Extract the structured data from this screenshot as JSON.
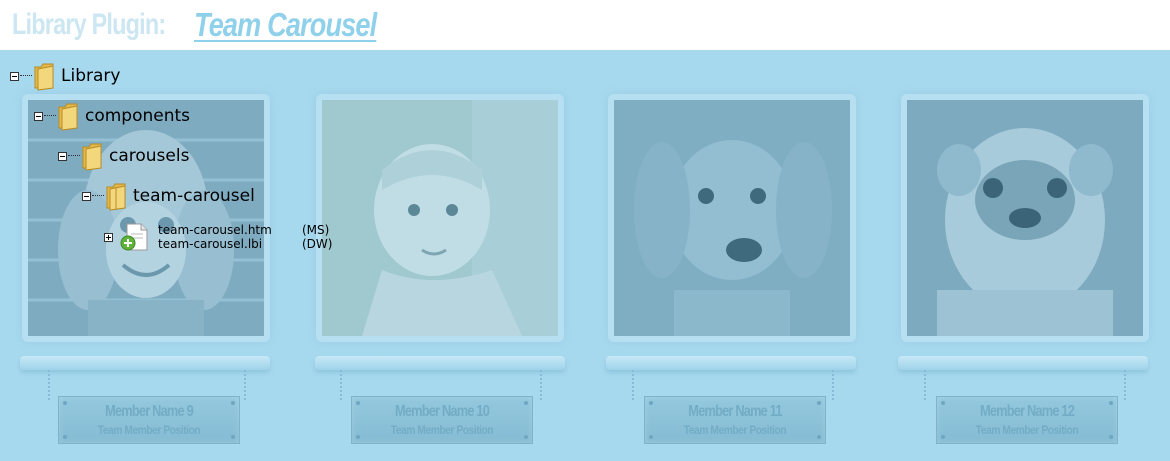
{
  "header": {
    "label": "Library Plugin:",
    "title_link": "Team Carousel"
  },
  "tree": {
    "root": "Library",
    "l1": "components",
    "l2": "carousels",
    "l3": "team-carousel",
    "files": [
      {
        "name": "team-carousel.htm",
        "tag": "(MS)"
      },
      {
        "name": "team-carousel.lbi",
        "tag": "(DW)"
      }
    ]
  },
  "members": [
    {
      "name": "Member Name 9",
      "position": "Team Member Position"
    },
    {
      "name": "Member Name 10",
      "position": "Team Member Position"
    },
    {
      "name": "Member Name 11",
      "position": "Team Member Position"
    },
    {
      "name": "Member Name 12",
      "position": "Team Member Position"
    }
  ],
  "colors": {
    "stage": "#a6d9ee",
    "header_link": "#8fd0ea",
    "header_label": "#cce6f2"
  },
  "icons": [
    "folder-icon",
    "file-icon",
    "add-icon",
    "collapse-icon",
    "expand-icon"
  ]
}
